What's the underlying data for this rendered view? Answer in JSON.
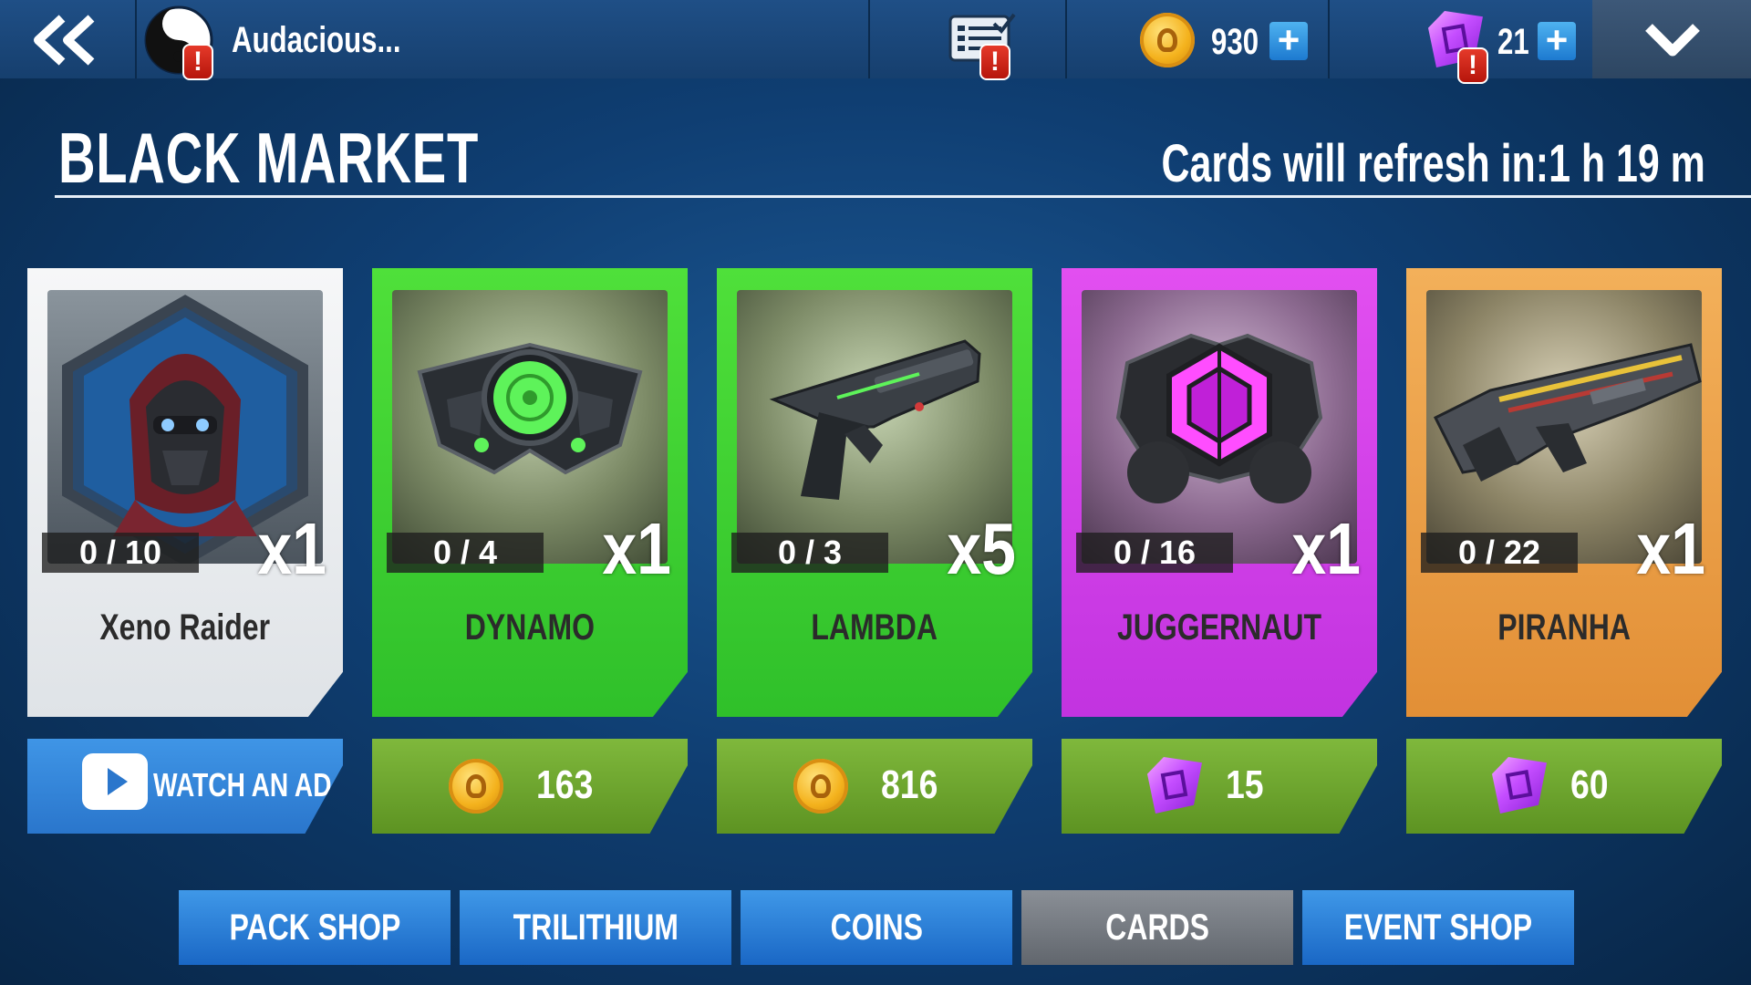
{
  "topbar": {
    "back_icon": "double-chevron-left-icon",
    "player_name": "Audacious...",
    "profile_icon": "yin-yang-icon",
    "alert_glyph": "!",
    "missions_icon": "checklist-icon",
    "coins": "930",
    "gems": "21",
    "plus_glyph": "+",
    "dropdown_icon": "chevron-down-icon"
  },
  "header": {
    "title": "BLACK MARKET",
    "refresh_text": "Cards will refresh in:1 h 19 m"
  },
  "cards": [
    {
      "name": "Xeno Raider",
      "count": "0 / 10",
      "multiplier": "x1",
      "rarity": "common",
      "price": "WATCH AN AD",
      "currency": "ad"
    },
    {
      "name": "DYNAMO",
      "count": "0 / 4",
      "multiplier": "x1",
      "rarity": "uncommon",
      "price": "163",
      "currency": "coin"
    },
    {
      "name": "LAMBDA",
      "count": "0 / 3",
      "multiplier": "x5",
      "rarity": "uncommon",
      "price": "816",
      "currency": "coin"
    },
    {
      "name": "JUGGERNAUT",
      "count": "0 / 16",
      "multiplier": "x1",
      "rarity": "epic",
      "price": "15",
      "currency": "gem"
    },
    {
      "name": "PIRANHA",
      "count": "0 / 22",
      "multiplier": "x1",
      "rarity": "legendary",
      "price": "60",
      "currency": "gem"
    }
  ],
  "tabs": [
    {
      "label": "PACK SHOP",
      "active": false
    },
    {
      "label": "TRILITHIUM",
      "active": false
    },
    {
      "label": "COINS",
      "active": false
    },
    {
      "label": "CARDS",
      "active": true
    },
    {
      "label": "EVENT SHOP",
      "active": false
    }
  ],
  "colors": {
    "common": "#e9ecef",
    "uncommon": "#43d62f",
    "epic": "#d33be6",
    "legendary": "#eda048",
    "buy_green": "#6fa82f",
    "ad_blue": "#2f83d6",
    "tab_blue": "#2a7fd6",
    "tab_active": "#767b82"
  }
}
